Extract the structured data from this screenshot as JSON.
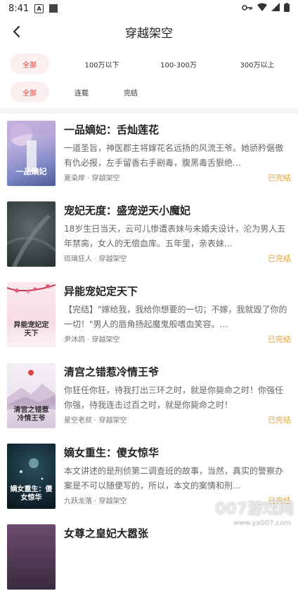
{
  "status_bar": {
    "time": "8:41"
  },
  "header": {
    "title": "穿越架空"
  },
  "filters": {
    "word_count": [
      "全部",
      "100万以下",
      "100-300万",
      "300万以上"
    ],
    "status": [
      "全部",
      "连载",
      "完结"
    ]
  },
  "books": [
    {
      "title": "一品嫡妃：舌灿莲花",
      "desc": "一道圣旨，神医郡主将嫁花名远扬的风流王爷。她骄矜倨傲有仇必报，左手留香右手剧毒，腹黑毒舌狠绝…",
      "author": "夏染岸 · 穿越架空",
      "status": "已完结",
      "cover_text": "一品嫡妃"
    },
    {
      "title": "宠妃无度：盛宠逆天小魔妃",
      "desc": "18岁生日当天，云可儿惨遭表妹与未婚夫设计，沦为男人五年禁脔，女人的无偿血库。五年里，亲表妹…",
      "author": "琉璃狂人 · 穿越架空",
      "status": "已完结",
      "cover_text": ""
    },
    {
      "title": "异能宠妃定天下",
      "desc": "【完结】\"嫁给我，我给你想要的一切；不嫁，我就毁了你的一切！\"男人的唇角扬起魔鬼般嗜血笑容。…",
      "author": "尹沐鸽 · 穿越架空",
      "status": "已完结",
      "cover_text": "异能宠妃定天下"
    },
    {
      "title": "清宫之错惹冷情王爷",
      "desc": "你狂任你狂，待我打出三环之时，就是你毙命之时！你强任你强，待我连击过百之时，就是你毙命之时！",
      "author": "星空老叔 · 穿越架空",
      "status": "已完结",
      "cover_text": "清宫之错惹冷情王爷"
    },
    {
      "title": "嫡女重生：傻女惊华",
      "desc": "本文讲述的是刑侦第二调查班的故事，当然，真实的警察办案是不可以随便写的，所以，本文的案情和刑…",
      "author": "九跃龙落 · 穿越架空",
      "status": "已完结",
      "cover_text": "嫡女重生：傻女惊华"
    },
    {
      "title": "女尊之皇妃大嚣张",
      "desc": "",
      "author": "",
      "status": "",
      "cover_text": ""
    }
  ],
  "watermark": {
    "main": "007游戏网",
    "sub": "www.yx007.com"
  }
}
